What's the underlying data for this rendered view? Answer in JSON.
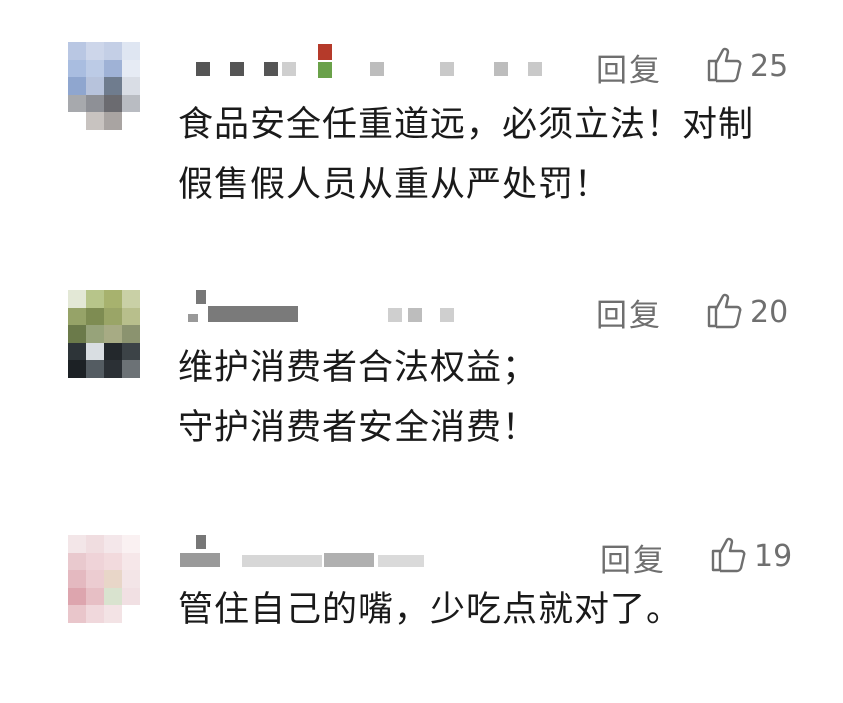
{
  "comments": [
    {
      "reply_label": "回复",
      "like_count": "25",
      "lines": [
        "食品安全任重道远，必须立法！对制",
        "假售假人员从重从严处罚！"
      ]
    },
    {
      "reply_label": "回复",
      "like_count": "20",
      "lines": [
        "维护消费者合法权益；",
        "守护消费者安全消费！"
      ]
    },
    {
      "reply_label": "回复",
      "like_count": "19",
      "lines": [
        "管住自己的嘴，少吃点就对了。"
      ]
    }
  ],
  "icons": {
    "like": "thumbs-up-icon"
  },
  "colors": {
    "meta_text": "#6f6f6f",
    "body_text": "#1a1a1a",
    "background": "#ffffff"
  }
}
